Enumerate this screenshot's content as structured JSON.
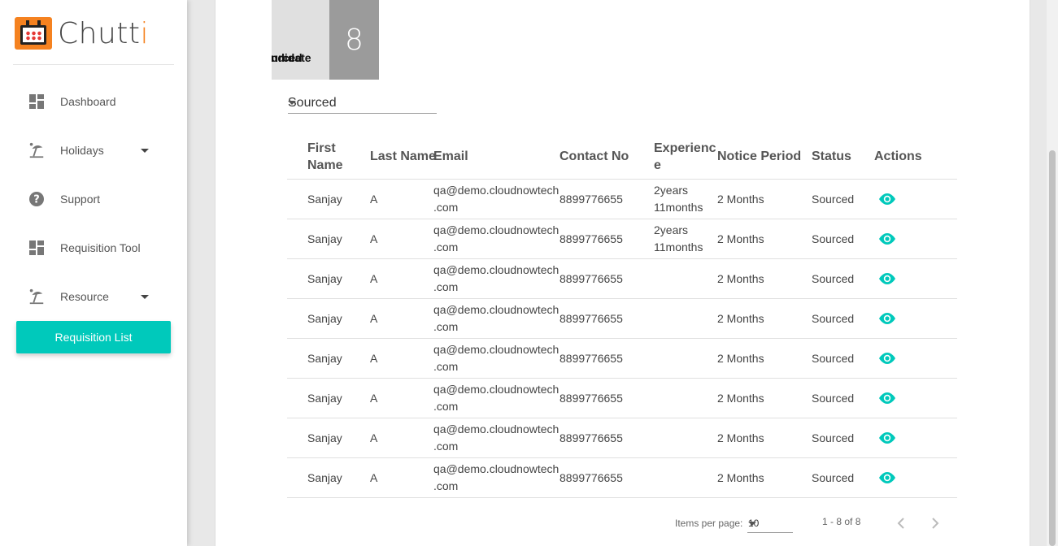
{
  "sidebar": {
    "brand": {
      "name_main": "Chutt",
      "name_accent": "i"
    },
    "items": [
      {
        "label": "Dashboard",
        "icon": "dashboard-icon",
        "has_caret": false
      },
      {
        "label": "Holidays",
        "icon": "beach-icon",
        "has_caret": true
      },
      {
        "label": "Support",
        "icon": "help-icon",
        "has_caret": false
      },
      {
        "label": "Requisition Tool",
        "icon": "dashboard-icon",
        "has_caret": false
      },
      {
        "label": "Resource",
        "icon": "beach-icon",
        "has_caret": true
      }
    ],
    "active_item": {
      "label": "Requisition List"
    }
  },
  "stat": {
    "label_line1": "ourced",
    "label_line2": "andidate",
    "value": "8"
  },
  "filter": {
    "selected": "Sourced"
  },
  "table": {
    "headers": {
      "first_name_1": "First",
      "first_name_2": "Name",
      "last_name": "Last Name",
      "email": "Email",
      "contact": "Contact No",
      "experience_1": "Experienc",
      "experience_2": "e",
      "notice": "Notice Period",
      "status": "Status",
      "actions": "Actions"
    },
    "rows": [
      {
        "first": "Sanjay",
        "last": "A",
        "email_1": "qa@demo.cloudnowtech",
        "email_2": ".com",
        "contact": "8899776655",
        "exp_1": "2years",
        "exp_2": "11months",
        "notice": "2 Months",
        "status": "Sourced"
      },
      {
        "first": "Sanjay",
        "last": "A",
        "email_1": "qa@demo.cloudnowtech",
        "email_2": ".com",
        "contact": "8899776655",
        "exp_1": "2years",
        "exp_2": "11months",
        "notice": "2 Months",
        "status": "Sourced"
      },
      {
        "first": "Sanjay",
        "last": "A",
        "email_1": "qa@demo.cloudnowtech",
        "email_2": ".com",
        "contact": "8899776655",
        "exp_1": "",
        "exp_2": "",
        "notice": "2 Months",
        "status": "Sourced"
      },
      {
        "first": "Sanjay",
        "last": "A",
        "email_1": "qa@demo.cloudnowtech",
        "email_2": ".com",
        "contact": "8899776655",
        "exp_1": "",
        "exp_2": "",
        "notice": "2 Months",
        "status": "Sourced"
      },
      {
        "first": "Sanjay",
        "last": "A",
        "email_1": "qa@demo.cloudnowtech",
        "email_2": ".com",
        "contact": "8899776655",
        "exp_1": "",
        "exp_2": "",
        "notice": "2 Months",
        "status": "Sourced"
      },
      {
        "first": "Sanjay",
        "last": "A",
        "email_1": "qa@demo.cloudnowtech",
        "email_2": ".com",
        "contact": "8899776655",
        "exp_1": "",
        "exp_2": "",
        "notice": "2 Months",
        "status": "Sourced"
      },
      {
        "first": "Sanjay",
        "last": "A",
        "email_1": "qa@demo.cloudnowtech",
        "email_2": ".com",
        "contact": "8899776655",
        "exp_1": "",
        "exp_2": "",
        "notice": "2 Months",
        "status": "Sourced"
      },
      {
        "first": "Sanjay",
        "last": "A",
        "email_1": "qa@demo.cloudnowtech",
        "email_2": ".com",
        "contact": "8899776655",
        "exp_1": "",
        "exp_2": "",
        "notice": "2 Months",
        "status": "Sourced"
      }
    ],
    "action_icon": "eye-icon"
  },
  "paginator": {
    "items_per_page_label": "Items per page:",
    "items_per_page": "10",
    "range": "1 - 8 of 8"
  },
  "colors": {
    "accent": "#00c9bb",
    "brand": "#f58220",
    "stat_value_bg": "#9b9b9b",
    "stat_label_bg": "#e0e0e0"
  }
}
